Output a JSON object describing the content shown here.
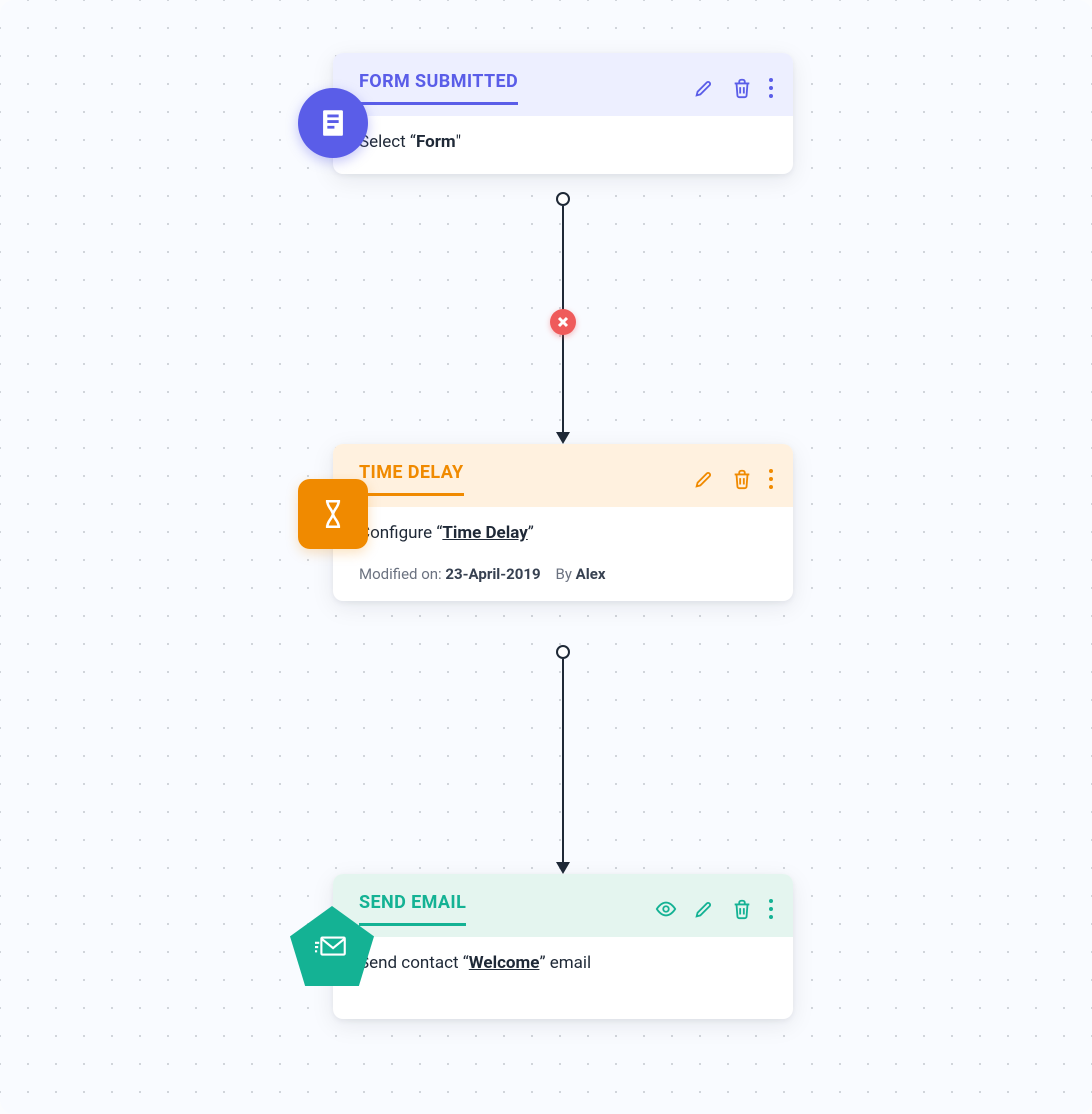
{
  "colors": {
    "purple": "#5a5de8",
    "orange": "#f08a00",
    "teal": "#14b294",
    "danger": "#ef5b5b"
  },
  "nodes": {
    "form": {
      "title": "FORM SUBMITTED",
      "body_prefix": "Select “",
      "body_highlight": "Form",
      "body_suffix": "\""
    },
    "delay": {
      "title": "TIME DELAY",
      "body_prefix": "Configure “",
      "body_highlight": "Time Delay",
      "body_suffix": "”",
      "meta_modified_label": "Modified on:",
      "meta_modified_value": "23-April-2019",
      "meta_by_label": "By",
      "meta_by_value": "Alex"
    },
    "email": {
      "title": "SEND EMAIL",
      "body_prefix": "Send contact “",
      "body_highlight": "Welcome",
      "body_suffix": "” email"
    }
  }
}
